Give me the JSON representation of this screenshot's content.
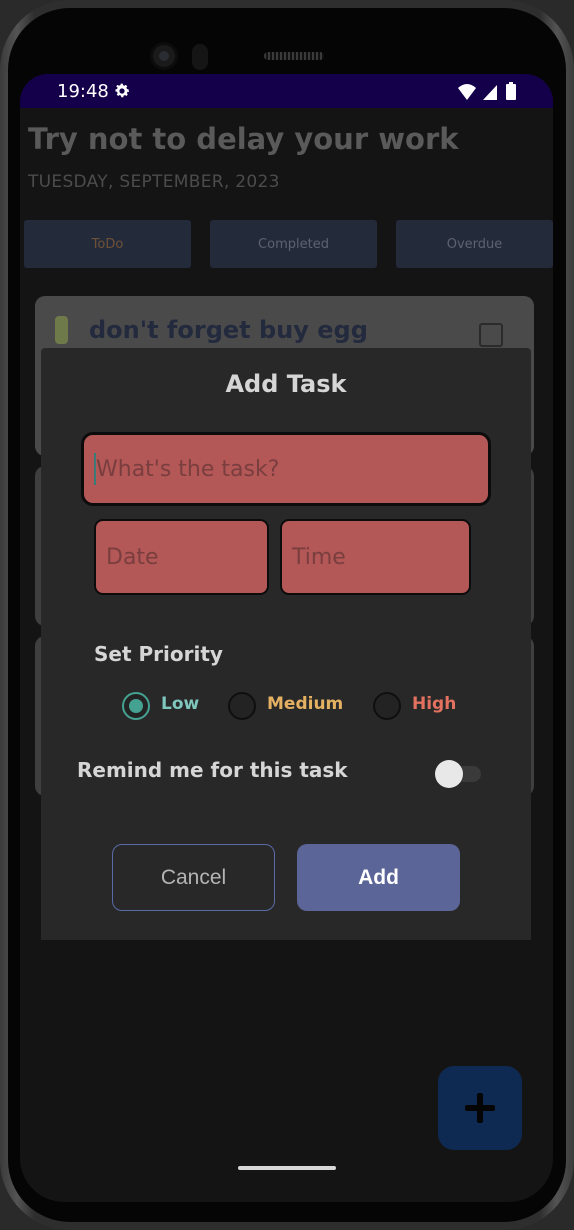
{
  "status_bar": {
    "time": "19:48",
    "icons": [
      "gear-icon",
      "wifi-icon",
      "signal-icon",
      "battery-icon"
    ]
  },
  "background": {
    "title": "Try not to delay your work",
    "date": "TUESDAY, SEPTEMBER, 2023",
    "tabs": [
      {
        "label": "ToDo"
      },
      {
        "label": "Completed"
      },
      {
        "label": "Overdue"
      }
    ],
    "first_task": "don't forget buy egg"
  },
  "dialog": {
    "title": "Add Task",
    "task_placeholder": "What's the task?",
    "date_placeholder": "Date",
    "time_placeholder": "Time",
    "priority_label": "Set Priority",
    "priorities": [
      {
        "label": "Low",
        "selected": true
      },
      {
        "label": "Medium",
        "selected": false
      },
      {
        "label": "High",
        "selected": false
      }
    ],
    "remind_label": "Remind me for this task",
    "remind_enabled": false,
    "cancel_label": "Cancel",
    "add_label": "Add"
  },
  "colors": {
    "field": "#b35757",
    "accent": "#5b6597",
    "low": "#7fc6bd",
    "medium": "#e4b062",
    "high": "#e2715f"
  }
}
